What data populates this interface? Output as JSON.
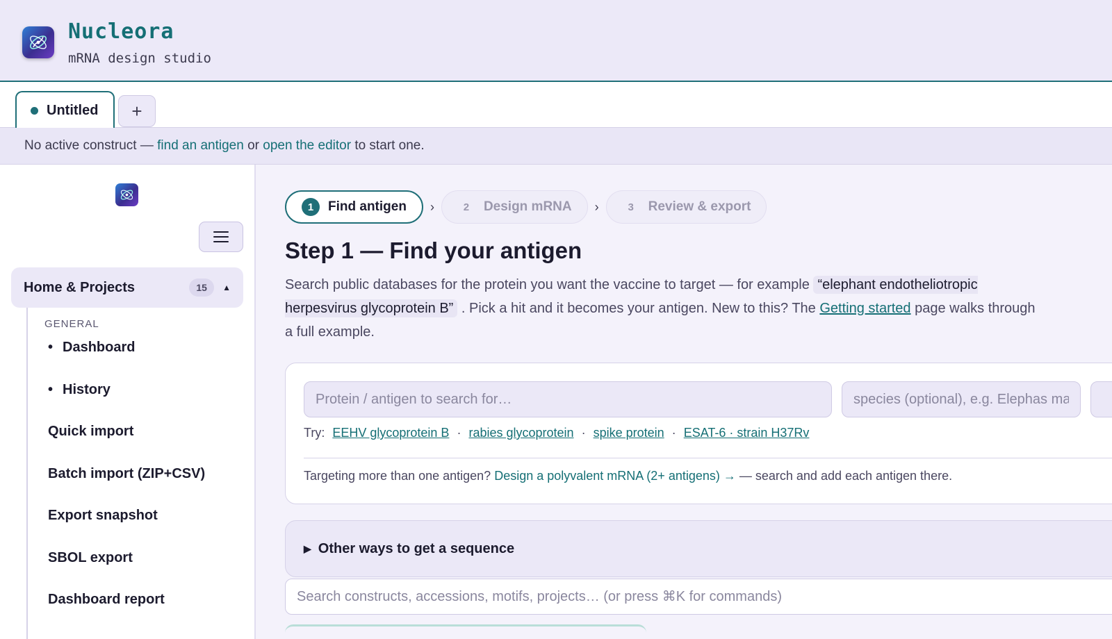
{
  "header": {
    "app_name": "Nucleora",
    "tagline": "mRNA design studio"
  },
  "tabs": [
    {
      "label": "Untitled",
      "active": true
    }
  ],
  "tab_add_label": "+",
  "notice": {
    "prefix": "No active construct — ",
    "link1": "find an antigen",
    "middle": " or ",
    "link2": "open the editor",
    "suffix": " to start one."
  },
  "sidebar": {
    "section": {
      "title": "Home & Projects",
      "count": "15",
      "caret": "▲"
    },
    "group_label": "GENERAL",
    "items": [
      {
        "label": "Dashboard"
      },
      {
        "label": "History"
      },
      {
        "label": "Quick import"
      },
      {
        "label": "Batch import (ZIP+CSV)"
      },
      {
        "label": "Export snapshot"
      },
      {
        "label": "SBOL export"
      },
      {
        "label": "Dashboard report"
      }
    ]
  },
  "steps": [
    {
      "num": "1",
      "label": "Find antigen",
      "active": true
    },
    {
      "num": "2",
      "label": "Design mRNA",
      "active": false
    },
    {
      "num": "3",
      "label": "Review & export",
      "active": false
    }
  ],
  "step_separator": "›",
  "page_title": "Step 1 — Find your antigen",
  "intro": {
    "text1": "Search public databases for the protein you want the vaccine to target — for example ",
    "example": "“elephant endotheliotropic herpesvirus glycoprotein B”",
    "text2": " . Pick a hit and it becomes your antigen. New to this? The ",
    "link": "Getting started",
    "text3": " page walks through a full example."
  },
  "search": {
    "protein_placeholder": "Protein / antigen to search for…",
    "species_placeholder": "species (optional), e.g. Elephas maximus",
    "try_label": "Try:",
    "suggestions": [
      "EEHV glycoprotein B",
      "rabies glycoprotein",
      "spike protein",
      "ESAT-6 · strain H37Rv"
    ],
    "suggestion_sep": "·",
    "poly_prefix": "Targeting more than one antigen? ",
    "poly_link": "Design a polyvalent mRNA (2+ antigens) →",
    "poly_suffix": " — search and add each antigen there."
  },
  "other_ways": {
    "label": "Other ways to get a sequence",
    "marker": "▶"
  },
  "global_search": {
    "placeholder": "Search constructs, accessions, motifs, projects… (or press ⌘K for commands)"
  },
  "colors": {
    "accent": "#1f6f78",
    "header_bg": "#ece9f8",
    "page_bg": "#f4f2fb"
  }
}
